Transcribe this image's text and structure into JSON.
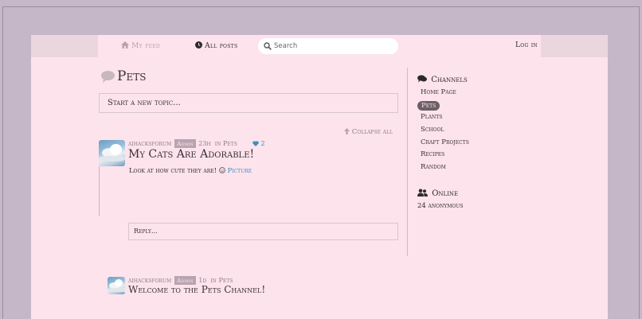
{
  "nav": {
    "my_feed": "My feed",
    "all_posts": "All posts",
    "search_placeholder": "Search",
    "login": "Log in"
  },
  "channel": {
    "title": "Pets",
    "new_topic_placeholder": "Start a new topic...",
    "collapse_all": "Collapse all"
  },
  "posts": [
    {
      "author": "aihacksforum",
      "role": "Admin",
      "time": "23h",
      "in_label": "in",
      "channel": "Pets",
      "likes": "2",
      "title": "My Cats Are Adorable!",
      "body": "Look at how cute they are!",
      "link_text": "Picture",
      "reply_placeholder": "Reply..."
    },
    {
      "author": "aihacksforum",
      "role": "Admin",
      "time": "1d",
      "in_label": "in",
      "channel": "Pets",
      "title": "Welcome to the Pets Channel!"
    }
  ],
  "sidebar": {
    "channels_heading": "Channels",
    "channels": [
      "Home Page",
      "Pets",
      "Plants",
      "School",
      "Craft Projects",
      "Recipes",
      "Random"
    ],
    "active_channel": "Pets",
    "online_heading": "Online",
    "online_count": "24 anonymous"
  },
  "colors": {
    "background": "#c6b7c8",
    "page": "#fde3ec",
    "active_channel": "#6c5f66",
    "link": "#3a8fc0",
    "badge": "#b8a4b0"
  },
  "icons": [
    "home-icon",
    "clock-icon",
    "search-icon",
    "speech-bubble-icon",
    "arrow-up-icon",
    "heart-icon",
    "smiley-icon",
    "comments-icon",
    "users-icon"
  ]
}
